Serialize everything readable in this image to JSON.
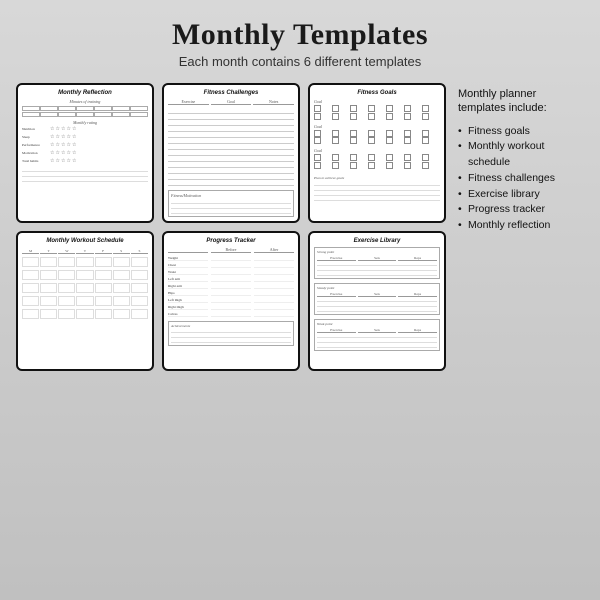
{
  "page": {
    "title": "Monthly Templates",
    "subtitle": "Each month contains 6 different templates"
  },
  "sidebar": {
    "heading": "Monthly planner templates include:",
    "items": [
      "Fitness goals",
      "Monthly workout schedule",
      "Fitness challenges",
      "Exercise library",
      "Progress tracker",
      "Monthly reflection"
    ]
  },
  "templates": [
    {
      "id": "monthly-reflection",
      "title": "Monthly Reflection"
    },
    {
      "id": "fitness-challenges",
      "title": "Fitness Challenges"
    },
    {
      "id": "fitness-goals",
      "title": "Fitness Goals"
    },
    {
      "id": "monthly-workout",
      "title": "Monthly Workout Schedule"
    },
    {
      "id": "progress-tracker",
      "title": "Progress Tracker"
    },
    {
      "id": "exercise-library",
      "title": "Exercise Library"
    }
  ],
  "workout_days": [
    "M",
    "T",
    "W",
    "T",
    "F",
    "S",
    "S"
  ],
  "tracker_metrics": [
    "Weight",
    "Chest",
    "Waist",
    "Left arm",
    "Right arm",
    "Hips",
    "Left thigh",
    "Right thigh",
    "Calves"
  ],
  "tracker_cols": [
    "Before",
    "After"
  ],
  "exercise_sections": [
    "Strong point",
    "Steady point",
    "Weak point"
  ]
}
